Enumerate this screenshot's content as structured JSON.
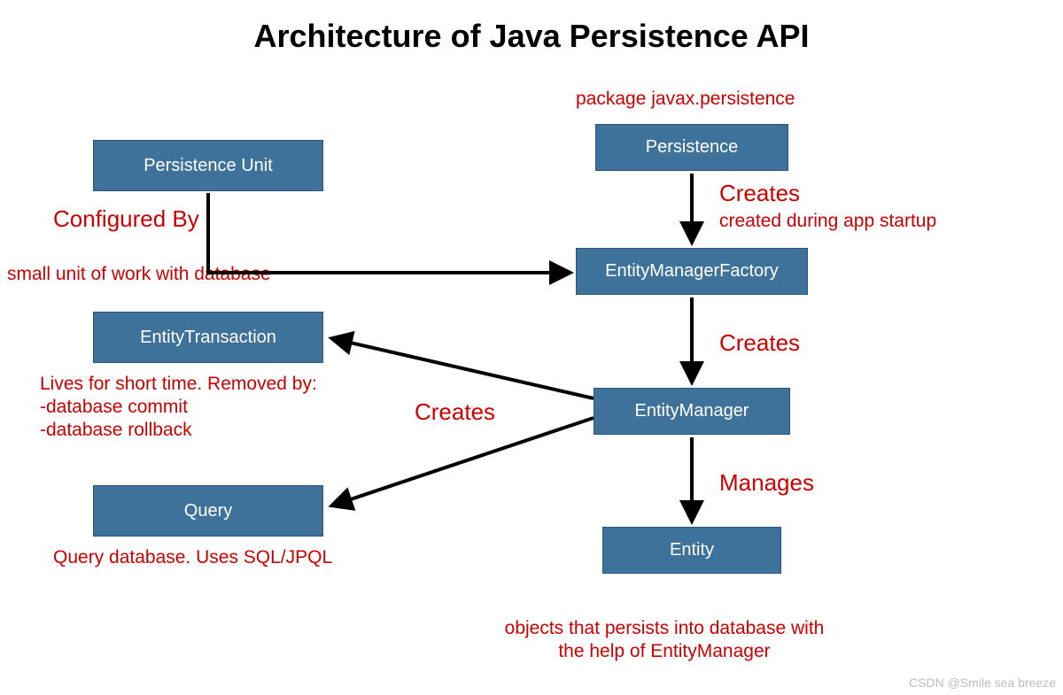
{
  "title": "Architecture of Java Persistence API",
  "boxes": {
    "persistence_unit": "Persistence Unit",
    "entity_transaction": "EntityTransaction",
    "query": "Query",
    "persistence": "Persistence",
    "emf": "EntityManagerFactory",
    "em": "EntityManager",
    "entity": "Entity"
  },
  "notes": {
    "package": "package javax.persistence",
    "configured_by": "Configured By",
    "small_unit": "small unit of work with database",
    "creates_1": "Creates",
    "created_startup": "created during app startup",
    "creates_2": "Creates",
    "creates_3": "Creates",
    "manages": "Manages",
    "lives_short_1": "Lives for short time. Removed by:",
    "lives_short_2": "-database commit",
    "lives_short_3": "-database rollback",
    "query_db": "Query database. Uses SQL/JPQL",
    "entity_desc_1": "objects that persists into database with",
    "entity_desc_2": "the help of EntityManager"
  },
  "watermark": "CSDN @Smile sea breeze"
}
